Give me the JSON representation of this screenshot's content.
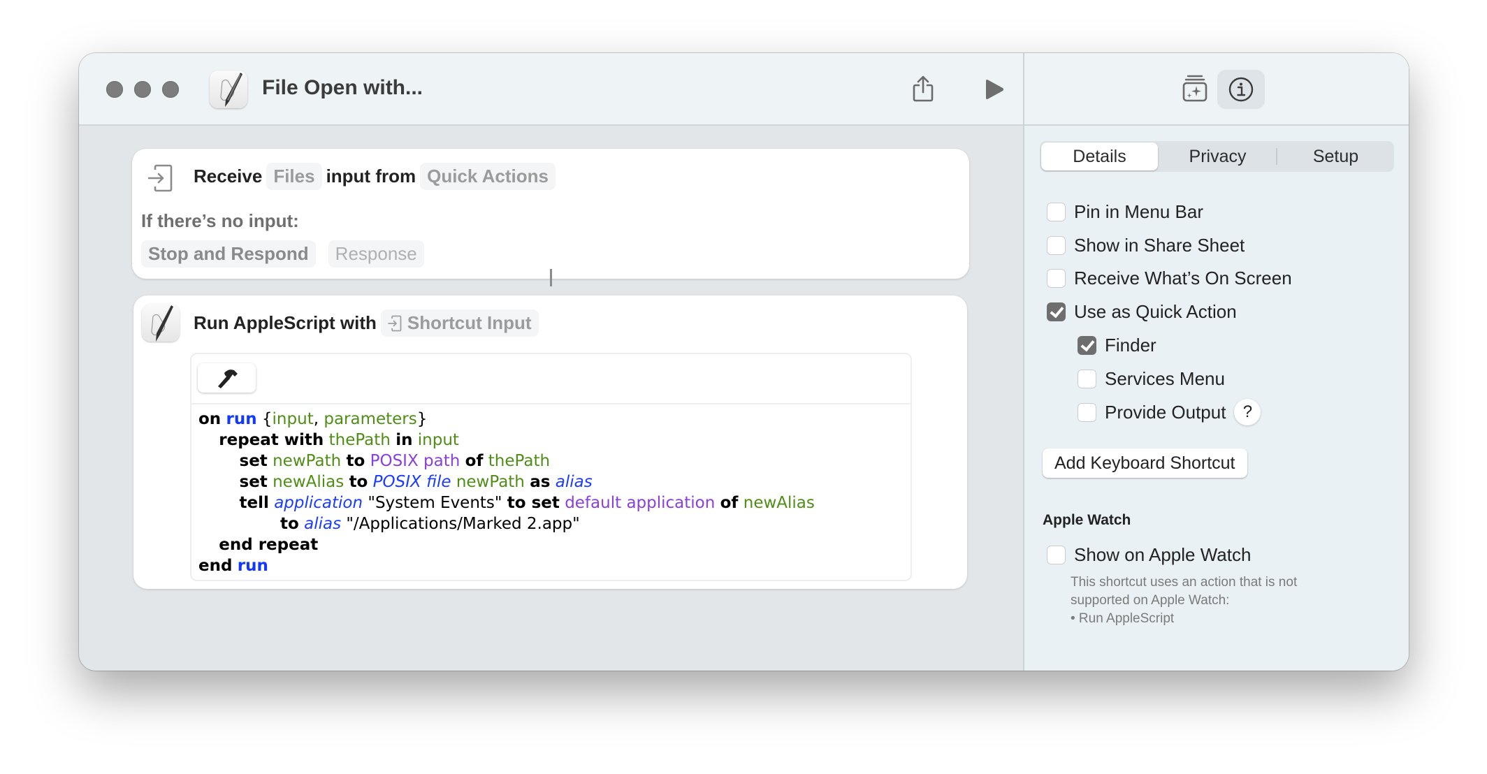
{
  "window": {
    "title": "File Open with...",
    "traffic_lights": [
      "close",
      "minimize",
      "zoom"
    ]
  },
  "toolbar": {
    "share_icon": "share-icon",
    "run_icon": "play-icon",
    "gallery_icon": "action-library-icon",
    "info_icon": "info-icon"
  },
  "receive_action": {
    "label_receive": "Receive",
    "input_type": "Files",
    "label_input_from": "input from",
    "source": "Quick Actions",
    "no_input_label": "If there’s no input:",
    "no_input_action": "Stop and Respond",
    "response_placeholder": "Response"
  },
  "applescript_action": {
    "label": "Run AppleScript with",
    "input_variable": "Shortcut Input",
    "compile_button_icon": "hammer-icon",
    "code_lines": [
      [
        {
          "t": "on",
          "c": "kw"
        },
        {
          "t": " "
        },
        {
          "t": "run",
          "c": "hb"
        },
        {
          "t": " {"
        },
        {
          "t": "input",
          "c": "var"
        },
        {
          "t": ", "
        },
        {
          "t": "parameters",
          "c": "var"
        },
        {
          "t": "}"
        }
      ],
      [
        {
          "t": "\t"
        },
        {
          "t": "repeat with",
          "c": "kw"
        },
        {
          "t": " "
        },
        {
          "t": "thePath",
          "c": "var"
        },
        {
          "t": " "
        },
        {
          "t": "in",
          "c": "kw"
        },
        {
          "t": " "
        },
        {
          "t": "input",
          "c": "var"
        }
      ],
      [
        {
          "t": "\t\t"
        },
        {
          "t": "set",
          "c": "kw"
        },
        {
          "t": " "
        },
        {
          "t": "newPath",
          "c": "var"
        },
        {
          "t": " "
        },
        {
          "t": "to",
          "c": "kw"
        },
        {
          "t": " "
        },
        {
          "t": "POSIX path",
          "c": "prop"
        },
        {
          "t": " "
        },
        {
          "t": "of",
          "c": "kw"
        },
        {
          "t": " "
        },
        {
          "t": "thePath",
          "c": "var"
        }
      ],
      [
        {
          "t": "\t\t"
        },
        {
          "t": "set",
          "c": "kw"
        },
        {
          "t": " "
        },
        {
          "t": "newAlias",
          "c": "var"
        },
        {
          "t": " "
        },
        {
          "t": "to",
          "c": "kw"
        },
        {
          "t": " "
        },
        {
          "t": "POSIX file",
          "c": "cls"
        },
        {
          "t": " "
        },
        {
          "t": "newPath",
          "c": "var"
        },
        {
          "t": " "
        },
        {
          "t": "as",
          "c": "kw"
        },
        {
          "t": " "
        },
        {
          "t": "alias",
          "c": "cls"
        }
      ],
      [
        {
          "t": "\t\t"
        },
        {
          "t": "tell",
          "c": "kw"
        },
        {
          "t": " "
        },
        {
          "t": "application",
          "c": "cls"
        },
        {
          "t": " \"System Events\" "
        },
        {
          "t": "to set",
          "c": "kw"
        },
        {
          "t": " "
        },
        {
          "t": "default application",
          "c": "prop"
        },
        {
          "t": " "
        },
        {
          "t": "of",
          "c": "kw"
        },
        {
          "t": " "
        },
        {
          "t": "newAlias",
          "c": "var"
        }
      ],
      [
        {
          "t": "\t\t\t\t"
        },
        {
          "t": "to",
          "c": "kw"
        },
        {
          "t": " "
        },
        {
          "t": "alias",
          "c": "cls"
        },
        {
          "t": " \"/Applications/Marked 2.app\""
        }
      ],
      [
        {
          "t": "\t"
        },
        {
          "t": "end repeat",
          "c": "kw"
        }
      ],
      [
        {
          "t": "end",
          "c": "kw"
        },
        {
          "t": " "
        },
        {
          "t": "run",
          "c": "hb"
        }
      ]
    ]
  },
  "sidebar": {
    "tabs": [
      {
        "label": "Details",
        "active": true
      },
      {
        "label": "Privacy",
        "active": false
      },
      {
        "label": "Setup",
        "active": false
      }
    ],
    "options": [
      {
        "label": "Pin in Menu Bar",
        "checked": false
      },
      {
        "label": "Show in Share Sheet",
        "checked": false
      },
      {
        "label": "Receive What’s On Screen",
        "checked": false
      },
      {
        "label": "Use as Quick Action",
        "checked": true
      }
    ],
    "quick_action_options": [
      {
        "label": "Finder",
        "checked": true
      },
      {
        "label": "Services Menu",
        "checked": false
      },
      {
        "label": "Provide Output",
        "checked": false
      }
    ],
    "help_label": "?",
    "add_shortcut_label": "Add Keyboard Shortcut",
    "apple_watch": {
      "heading": "Apple Watch",
      "option": {
        "label": "Show on Apple Watch",
        "checked": false
      },
      "note_lines": [
        "This shortcut uses an action that is not",
        "supported on Apple Watch:",
        "• Run AppleScript"
      ]
    }
  }
}
